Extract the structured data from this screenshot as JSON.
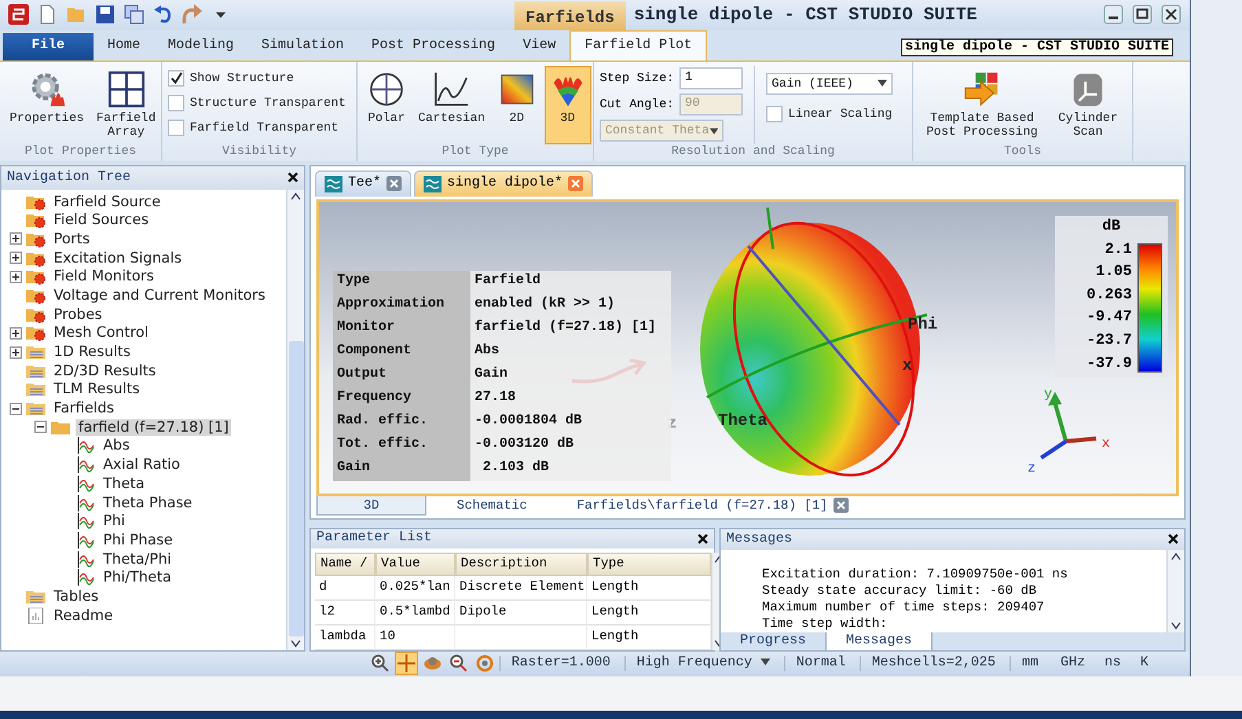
{
  "window": {
    "title": "single dipole - CST STUDIO SUITE",
    "context_group": "Farfields",
    "tooltip": "single dipole - CST STUDIO SUITE"
  },
  "ribbon_tabs": [
    {
      "label": "File",
      "kind": "file",
      "selected": false
    },
    {
      "label": "Home",
      "kind": "tab",
      "selected": false
    },
    {
      "label": "Modeling",
      "kind": "tab",
      "selected": false
    },
    {
      "label": "Simulation",
      "kind": "tab",
      "selected": false
    },
    {
      "label": "Post Processing",
      "kind": "tab",
      "selected": false
    },
    {
      "label": "View",
      "kind": "tab",
      "selected": false
    },
    {
      "label": "Farfield Plot",
      "kind": "context",
      "selected": true
    }
  ],
  "ribbon": {
    "plot_properties": {
      "label": "Plot Properties",
      "buttons": [
        {
          "label": "Properties",
          "kind": "gear"
        },
        {
          "label": "Farfield Array",
          "kind": "grid"
        }
      ]
    },
    "visibility": {
      "label": "Visibility",
      "checkboxes": [
        {
          "label": "Show Structure",
          "checked": true
        },
        {
          "label": "Structure Transparent",
          "checked": false
        },
        {
          "label": "Farfield Transparent",
          "checked": false
        }
      ]
    },
    "plot_type": {
      "label": "Plot Type",
      "buttons": [
        {
          "label": "Polar",
          "kind": "polar",
          "selected": false
        },
        {
          "label": "Cartesian",
          "kind": "cartesian",
          "selected": false
        },
        {
          "label": "2D",
          "kind": "map",
          "selected": false
        },
        {
          "label": "3D",
          "kind": "lobes",
          "selected": true
        }
      ]
    },
    "resolution": {
      "label": "Resolution and Scaling",
      "step_size": {
        "label": "Step Size:",
        "value": "1",
        "disabled": false
      },
      "cut_angle": {
        "label": "Cut Angle:",
        "value": "90",
        "disabled": true
      },
      "cut_type": {
        "value": "Constant Theta",
        "disabled": true
      },
      "scaling": {
        "value": "Gain (IEEE)"
      },
      "linear_scaling": {
        "label": "Linear Scaling",
        "checked": false
      }
    },
    "tools": {
      "label": "Tools",
      "buttons": [
        {
          "label": "Template Based Post Processing",
          "kind": "template"
        },
        {
          "label": "Cylinder Scan",
          "kind": "cylinder"
        }
      ]
    }
  },
  "navigation_tree": {
    "title": "Navigation Tree",
    "items": [
      {
        "label": "Farfield Source",
        "kind": "source",
        "selected": false
      },
      {
        "label": "Field Sources",
        "kind": "source",
        "selected": false
      },
      {
        "label": "Ports",
        "kind": "source",
        "expanded": false,
        "selected": false
      },
      {
        "label": "Excitation Signals",
        "kind": "source",
        "expanded": false,
        "selected": false
      },
      {
        "label": "Field Monitors",
        "kind": "source",
        "expanded": false,
        "selected": false
      },
      {
        "label": "Voltage and Current Monitors",
        "kind": "source",
        "selected": false
      },
      {
        "label": "Probes",
        "kind": "source",
        "selected": false
      },
      {
        "label": "Mesh Control",
        "kind": "source",
        "expanded": false,
        "selected": false
      },
      {
        "label": "1D Results",
        "kind": "results",
        "expanded": false,
        "selected": false
      },
      {
        "label": "2D/3D Results",
        "kind": "results",
        "selected": false
      },
      {
        "label": "TLM Results",
        "kind": "results",
        "selected": false
      },
      {
        "label": "Farfields",
        "kind": "results",
        "expanded": true,
        "selected": false,
        "children": [
          {
            "label": "farfield (f=27.18) [1]",
            "kind": "folder",
            "expanded": true,
            "selected": true,
            "children": [
              {
                "label": "Abs",
                "kind": "plot",
                "selected": false
              },
              {
                "label": "Axial Ratio",
                "kind": "plot",
                "selected": false
              },
              {
                "label": "Theta",
                "kind": "plot",
                "selected": false
              },
              {
                "label": "Theta Phase",
                "kind": "plot",
                "selected": false
              },
              {
                "label": "Phi",
                "kind": "plot",
                "selected": false
              },
              {
                "label": "Phi Phase",
                "kind": "plot",
                "selected": false
              },
              {
                "label": "Theta/Phi",
                "kind": "plot",
                "selected": false
              },
              {
                "label": "Phi/Theta",
                "kind": "plot",
                "selected": false
              }
            ]
          }
        ]
      },
      {
        "label": "Tables",
        "kind": "results",
        "selected": false
      },
      {
        "label": "Readme",
        "kind": "document",
        "selected": false
      }
    ]
  },
  "document_tabs": [
    {
      "label": "Tee*",
      "selected": false
    },
    {
      "label": "single dipole*",
      "selected": true
    }
  ],
  "viewport": {
    "info": [
      {
        "label": "Type",
        "value": "Farfield"
      },
      {
        "label": "Approximation",
        "value": "enabled (kR >> 1)"
      },
      {
        "label": "Monitor",
        "value": "farfield (f=27.18) [1]"
      },
      {
        "label": "Component",
        "value": "Abs"
      },
      {
        "label": "Output",
        "value": "Gain"
      },
      {
        "label": "Frequency",
        "value": "27.18"
      },
      {
        "label": "Rad. effic.",
        "value": "-0.0001804 dB"
      },
      {
        "label": "Tot. effic.",
        "value": "-0.003120 dB"
      },
      {
        "label": "Gain",
        "value": " 2.103 dB"
      }
    ],
    "axis_labels": {
      "phi": "Phi",
      "theta": "Theta",
      "x": "x",
      "z": "z"
    },
    "legend": {
      "title": "dB",
      "ticks": [
        "2.1",
        "1.05",
        "0.263",
        "-9.47",
        "-23.7",
        "-37.9"
      ]
    },
    "triad_labels": {
      "y": "y",
      "x": "x",
      "z": "z"
    }
  },
  "view_tabs": [
    {
      "label": "3D",
      "selected": true,
      "closable": false
    },
    {
      "label": "Schematic",
      "selected": false,
      "closable": false
    },
    {
      "label": "Farfields\\farfield (f=27.18) [1]",
      "selected": false,
      "closable": true
    }
  ],
  "parameter_list": {
    "title": "Parameter List",
    "columns": [
      "Name /",
      "Value",
      "Description",
      "Type"
    ],
    "rows": [
      [
        "d",
        "0.025*lan",
        "Discrete Element",
        "Length"
      ],
      [
        "l2",
        "0.5*lambd",
        "Dipole",
        "Length"
      ],
      [
        "lambda",
        "10",
        null,
        "Length"
      ]
    ]
  },
  "messages": {
    "title": "Messages",
    "lines": [
      "Excitation duration: 7.10909750e-001 ns",
      "Steady state accuracy limit: -60 dB",
      "Maximum number of time steps: 209407",
      "Time step width:"
    ],
    "tabs": [
      {
        "label": "Progress",
        "selected": false
      },
      {
        "label": "Messages",
        "selected": true
      }
    ]
  },
  "status_bar": {
    "tools": [
      {
        "kind": "zoom-in",
        "selected": false
      },
      {
        "kind": "pan",
        "selected": true
      },
      {
        "kind": "rotate",
        "selected": false
      },
      {
        "kind": "zoom",
        "selected": false
      },
      {
        "kind": "reset",
        "selected": false
      }
    ],
    "raster": "Raster=1.000",
    "solver": "High Frequency",
    "mode": "Normal",
    "meshcells": "Meshcells=2,025",
    "units": [
      "mm",
      "GHz",
      "ns",
      "K"
    ]
  }
}
